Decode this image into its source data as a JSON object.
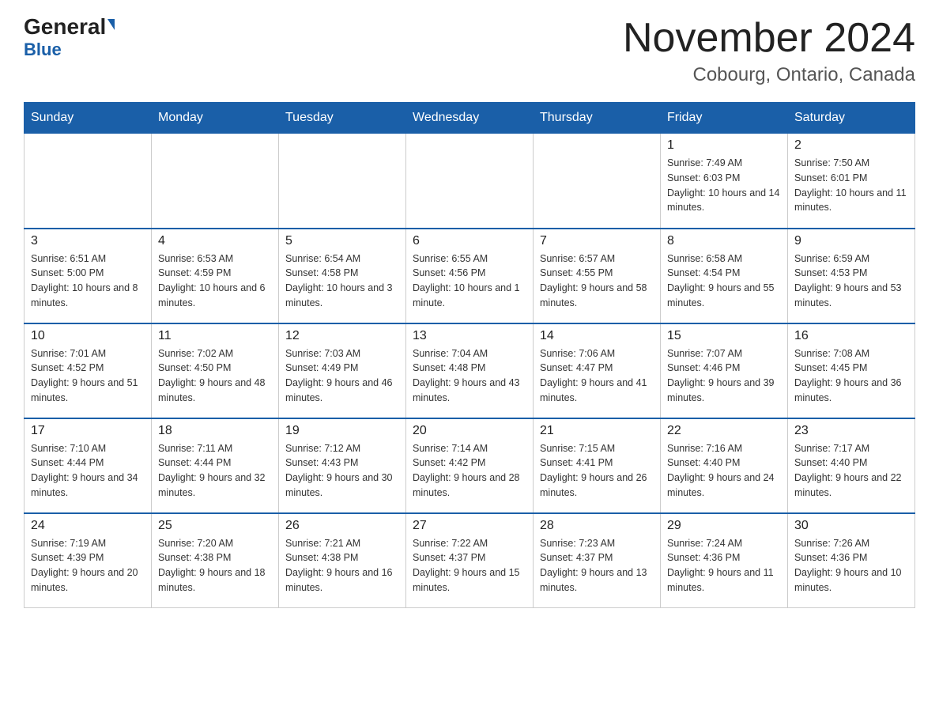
{
  "header": {
    "logo_general": "General",
    "logo_blue": "Blue",
    "title": "November 2024",
    "subtitle": "Cobourg, Ontario, Canada"
  },
  "weekdays": [
    "Sunday",
    "Monday",
    "Tuesday",
    "Wednesday",
    "Thursday",
    "Friday",
    "Saturday"
  ],
  "weeks": [
    [
      {
        "day": "",
        "sunrise": "",
        "sunset": "",
        "daylight": ""
      },
      {
        "day": "",
        "sunrise": "",
        "sunset": "",
        "daylight": ""
      },
      {
        "day": "",
        "sunrise": "",
        "sunset": "",
        "daylight": ""
      },
      {
        "day": "",
        "sunrise": "",
        "sunset": "",
        "daylight": ""
      },
      {
        "day": "",
        "sunrise": "",
        "sunset": "",
        "daylight": ""
      },
      {
        "day": "1",
        "sunrise": "Sunrise: 7:49 AM",
        "sunset": "Sunset: 6:03 PM",
        "daylight": "Daylight: 10 hours and 14 minutes."
      },
      {
        "day": "2",
        "sunrise": "Sunrise: 7:50 AM",
        "sunset": "Sunset: 6:01 PM",
        "daylight": "Daylight: 10 hours and 11 minutes."
      }
    ],
    [
      {
        "day": "3",
        "sunrise": "Sunrise: 6:51 AM",
        "sunset": "Sunset: 5:00 PM",
        "daylight": "Daylight: 10 hours and 8 minutes."
      },
      {
        "day": "4",
        "sunrise": "Sunrise: 6:53 AM",
        "sunset": "Sunset: 4:59 PM",
        "daylight": "Daylight: 10 hours and 6 minutes."
      },
      {
        "day": "5",
        "sunrise": "Sunrise: 6:54 AM",
        "sunset": "Sunset: 4:58 PM",
        "daylight": "Daylight: 10 hours and 3 minutes."
      },
      {
        "day": "6",
        "sunrise": "Sunrise: 6:55 AM",
        "sunset": "Sunset: 4:56 PM",
        "daylight": "Daylight: 10 hours and 1 minute."
      },
      {
        "day": "7",
        "sunrise": "Sunrise: 6:57 AM",
        "sunset": "Sunset: 4:55 PM",
        "daylight": "Daylight: 9 hours and 58 minutes."
      },
      {
        "day": "8",
        "sunrise": "Sunrise: 6:58 AM",
        "sunset": "Sunset: 4:54 PM",
        "daylight": "Daylight: 9 hours and 55 minutes."
      },
      {
        "day": "9",
        "sunrise": "Sunrise: 6:59 AM",
        "sunset": "Sunset: 4:53 PM",
        "daylight": "Daylight: 9 hours and 53 minutes."
      }
    ],
    [
      {
        "day": "10",
        "sunrise": "Sunrise: 7:01 AM",
        "sunset": "Sunset: 4:52 PM",
        "daylight": "Daylight: 9 hours and 51 minutes."
      },
      {
        "day": "11",
        "sunrise": "Sunrise: 7:02 AM",
        "sunset": "Sunset: 4:50 PM",
        "daylight": "Daylight: 9 hours and 48 minutes."
      },
      {
        "day": "12",
        "sunrise": "Sunrise: 7:03 AM",
        "sunset": "Sunset: 4:49 PM",
        "daylight": "Daylight: 9 hours and 46 minutes."
      },
      {
        "day": "13",
        "sunrise": "Sunrise: 7:04 AM",
        "sunset": "Sunset: 4:48 PM",
        "daylight": "Daylight: 9 hours and 43 minutes."
      },
      {
        "day": "14",
        "sunrise": "Sunrise: 7:06 AM",
        "sunset": "Sunset: 4:47 PM",
        "daylight": "Daylight: 9 hours and 41 minutes."
      },
      {
        "day": "15",
        "sunrise": "Sunrise: 7:07 AM",
        "sunset": "Sunset: 4:46 PM",
        "daylight": "Daylight: 9 hours and 39 minutes."
      },
      {
        "day": "16",
        "sunrise": "Sunrise: 7:08 AM",
        "sunset": "Sunset: 4:45 PM",
        "daylight": "Daylight: 9 hours and 36 minutes."
      }
    ],
    [
      {
        "day": "17",
        "sunrise": "Sunrise: 7:10 AM",
        "sunset": "Sunset: 4:44 PM",
        "daylight": "Daylight: 9 hours and 34 minutes."
      },
      {
        "day": "18",
        "sunrise": "Sunrise: 7:11 AM",
        "sunset": "Sunset: 4:44 PM",
        "daylight": "Daylight: 9 hours and 32 minutes."
      },
      {
        "day": "19",
        "sunrise": "Sunrise: 7:12 AM",
        "sunset": "Sunset: 4:43 PM",
        "daylight": "Daylight: 9 hours and 30 minutes."
      },
      {
        "day": "20",
        "sunrise": "Sunrise: 7:14 AM",
        "sunset": "Sunset: 4:42 PM",
        "daylight": "Daylight: 9 hours and 28 minutes."
      },
      {
        "day": "21",
        "sunrise": "Sunrise: 7:15 AM",
        "sunset": "Sunset: 4:41 PM",
        "daylight": "Daylight: 9 hours and 26 minutes."
      },
      {
        "day": "22",
        "sunrise": "Sunrise: 7:16 AM",
        "sunset": "Sunset: 4:40 PM",
        "daylight": "Daylight: 9 hours and 24 minutes."
      },
      {
        "day": "23",
        "sunrise": "Sunrise: 7:17 AM",
        "sunset": "Sunset: 4:40 PM",
        "daylight": "Daylight: 9 hours and 22 minutes."
      }
    ],
    [
      {
        "day": "24",
        "sunrise": "Sunrise: 7:19 AM",
        "sunset": "Sunset: 4:39 PM",
        "daylight": "Daylight: 9 hours and 20 minutes."
      },
      {
        "day": "25",
        "sunrise": "Sunrise: 7:20 AM",
        "sunset": "Sunset: 4:38 PM",
        "daylight": "Daylight: 9 hours and 18 minutes."
      },
      {
        "day": "26",
        "sunrise": "Sunrise: 7:21 AM",
        "sunset": "Sunset: 4:38 PM",
        "daylight": "Daylight: 9 hours and 16 minutes."
      },
      {
        "day": "27",
        "sunrise": "Sunrise: 7:22 AM",
        "sunset": "Sunset: 4:37 PM",
        "daylight": "Daylight: 9 hours and 15 minutes."
      },
      {
        "day": "28",
        "sunrise": "Sunrise: 7:23 AM",
        "sunset": "Sunset: 4:37 PM",
        "daylight": "Daylight: 9 hours and 13 minutes."
      },
      {
        "day": "29",
        "sunrise": "Sunrise: 7:24 AM",
        "sunset": "Sunset: 4:36 PM",
        "daylight": "Daylight: 9 hours and 11 minutes."
      },
      {
        "day": "30",
        "sunrise": "Sunrise: 7:26 AM",
        "sunset": "Sunset: 4:36 PM",
        "daylight": "Daylight: 9 hours and 10 minutes."
      }
    ]
  ]
}
